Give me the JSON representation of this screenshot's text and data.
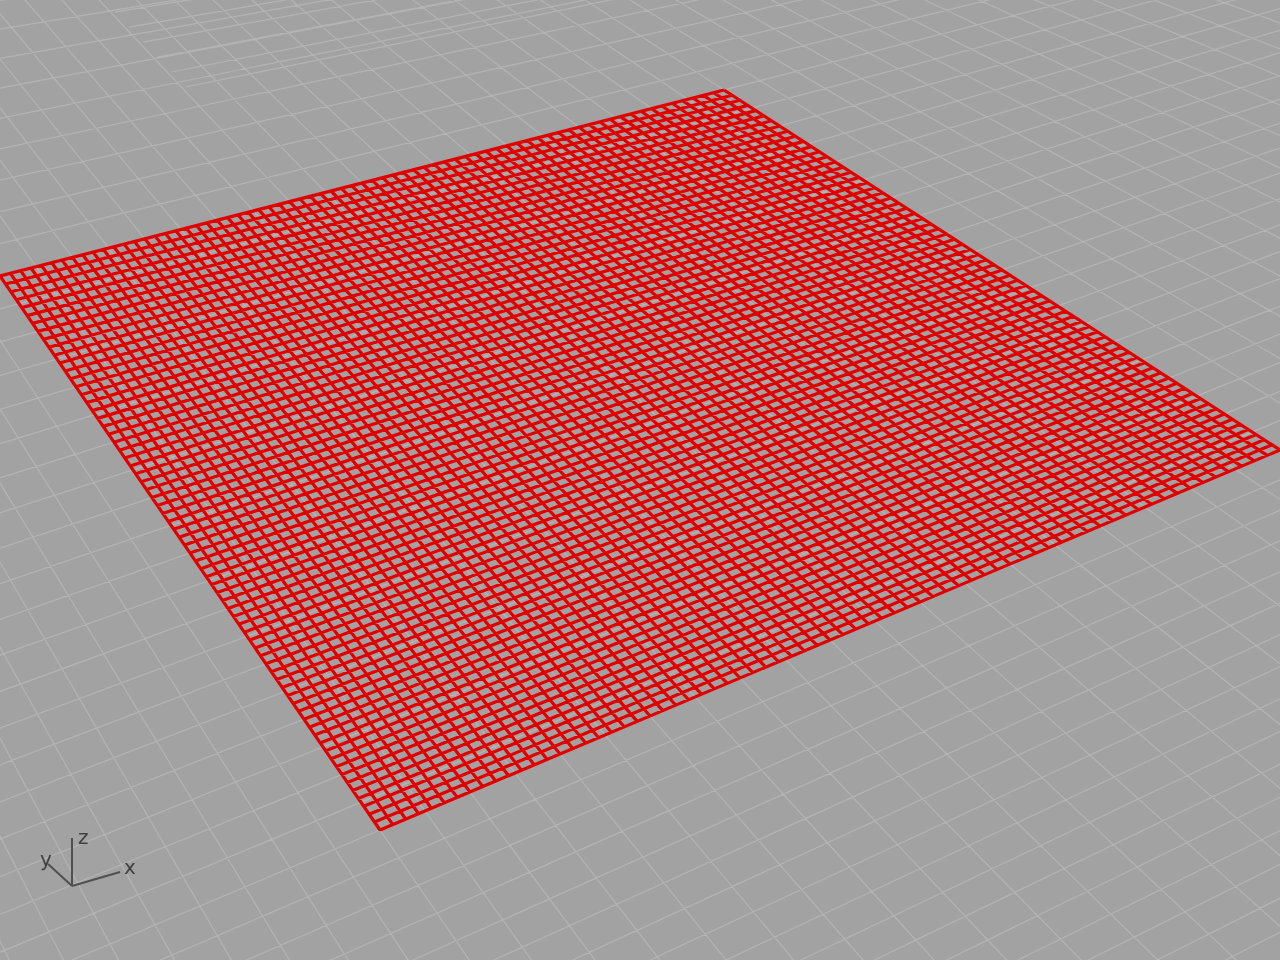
{
  "axes_indicator": {
    "z_label": "z",
    "y_label": "y",
    "x_label": "x"
  }
}
